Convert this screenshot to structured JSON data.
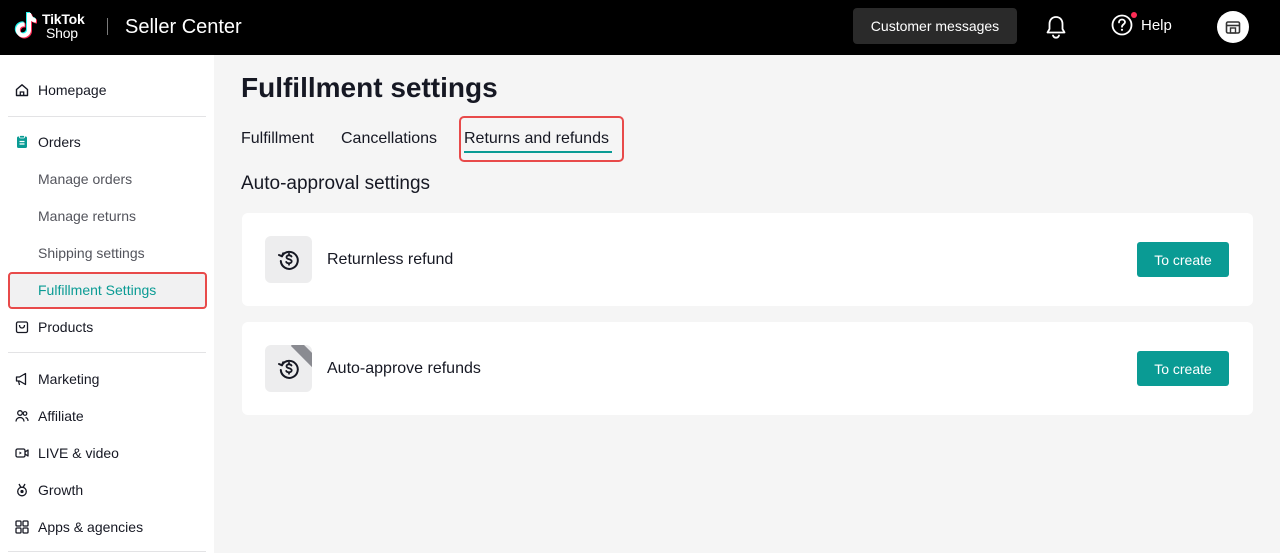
{
  "header": {
    "logo_brand": "TikTok",
    "logo_sub": "Shop",
    "app_title": "Seller Center",
    "customer_messages_label": "Customer messages",
    "help_label": "Help"
  },
  "sidebar": {
    "homepage": "Homepage",
    "orders": "Orders",
    "orders_sub": [
      "Manage orders",
      "Manage returns",
      "Shipping settings",
      "Fulfillment Settings"
    ],
    "products": "Products",
    "marketing": "Marketing",
    "affiliate": "Affiliate",
    "live_video": "LIVE & video",
    "growth": "Growth",
    "apps_agencies": "Apps & agencies"
  },
  "main": {
    "title": "Fulfillment settings",
    "tabs": [
      {
        "label": "Fulfillment"
      },
      {
        "label": "Cancellations"
      },
      {
        "label": "Returns and refunds",
        "active": true
      }
    ],
    "section_title": "Auto-approval settings",
    "cards": [
      {
        "label": "Returnless refund",
        "button": "To create",
        "icon": "refund-cycle-dollar-icon"
      },
      {
        "label": "Auto-approve refunds",
        "button": "To create",
        "icon": "refund-cycle-dollar-icon"
      }
    ]
  },
  "colors": {
    "accent": "#0a9b94",
    "highlight_border": "#e84a4a",
    "topbar": "#000000"
  }
}
